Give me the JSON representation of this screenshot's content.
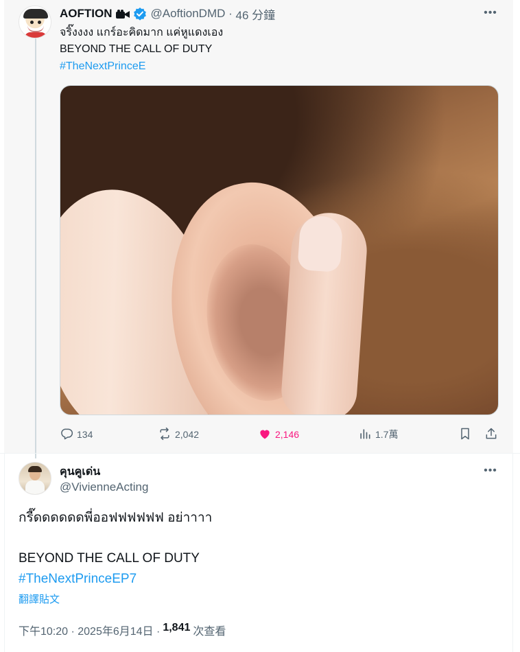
{
  "quoted_tweet": {
    "author_name": "AOFTION",
    "author_handle": "@AoftionDMD",
    "separator": "·",
    "time": "46 分鐘",
    "text_line1": "จริ๊งงงง แกร์อะคิดมาก แค่หูแดงเอง",
    "text_line2": "BEYOND THE CALL OF DUTY",
    "hashtag": "#TheNextPrinceE",
    "more": "•••",
    "actions": {
      "replies": "134",
      "reposts": "2,042",
      "likes": "2,146",
      "views": "1.7萬"
    },
    "icons": [
      "camera-icon",
      "verified-badge-icon",
      "reply-icon",
      "repost-icon",
      "like-icon",
      "views-icon",
      "bookmark-icon",
      "share-icon"
    ]
  },
  "main_tweet": {
    "author_name": "คุนคูเด่น",
    "author_handle": "@VivienneActing",
    "more": "•••",
    "text_line1": "กรี๊ดดดดดดพี่ออฟฟฟฟฟฟ อย่าาาา",
    "text_line2": "BEYOND THE CALL OF DUTY",
    "hashtag": "#TheNextPrinceEP7",
    "translate": "翻譯貼文",
    "timestamp": "下午10:20 · 2025年6月14日 · ",
    "views_count": "1,841",
    "views_label": "次查看"
  },
  "colors": {
    "link": "#1d9bf0",
    "like": "#f91880",
    "secondary_text": "#536471",
    "verified": "#1d9bf0"
  }
}
